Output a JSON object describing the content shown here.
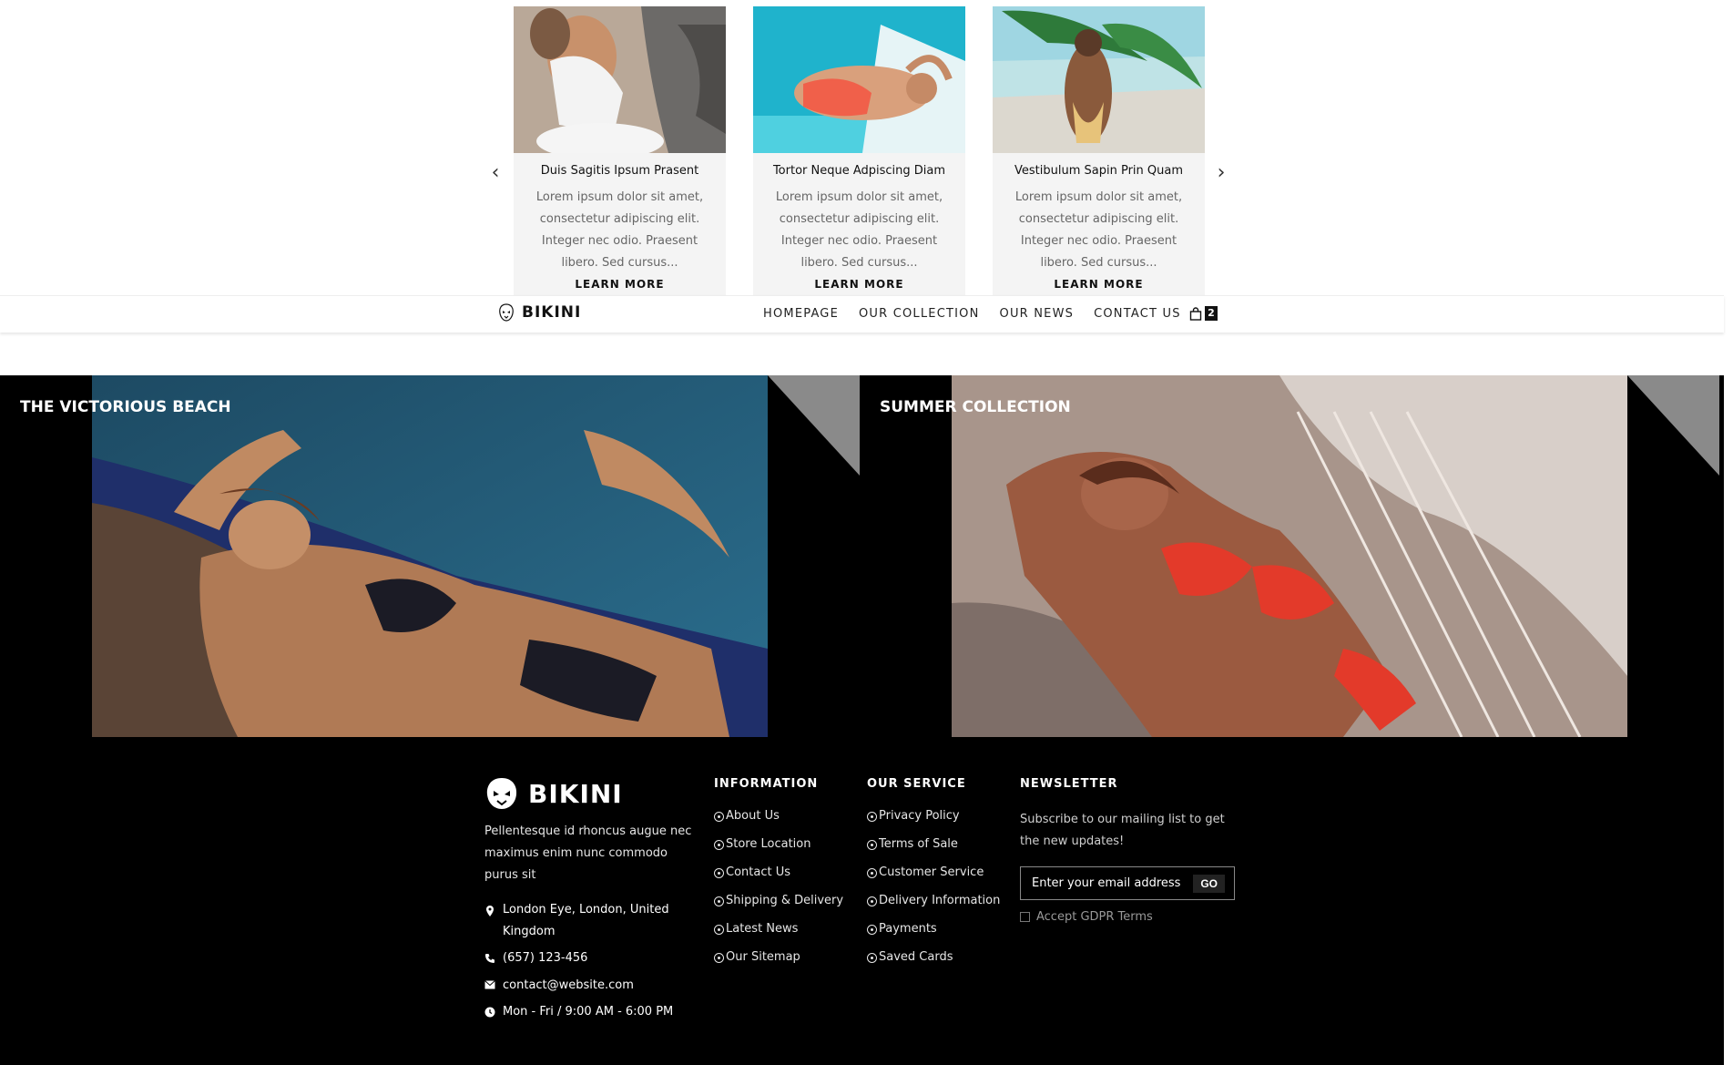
{
  "carousel": {
    "prev_icon": "chevron-left-icon",
    "next_icon": "chevron-right-icon",
    "cards": [
      {
        "title": "Duis Sagitis Ipsum Prasent",
        "text": "Lorem ipsum dolor sit amet, consectetur adipiscing elit. Integer nec odio. Praesent libero. Sed cursus...",
        "more": "LEARN MORE"
      },
      {
        "title": "Tortor Neque Adpiscing Diam",
        "text": "Lorem ipsum dolor sit amet, consectetur adipiscing elit. Integer nec odio. Praesent libero. Sed cursus...",
        "more": "LEARN MORE"
      },
      {
        "title": "Vestibulum Sapin Prin Quam",
        "text": "Lorem ipsum dolor sit amet, consectetur adipiscing elit. Integer nec odio. Praesent libero. Sed cursus...",
        "more": "LEARN MORE"
      }
    ]
  },
  "header": {
    "logo": "BIKINI",
    "nav": [
      "HOMEPAGE",
      "OUR COLLECTION",
      "OUR NEWS",
      "CONTACT US"
    ],
    "cart_icon": "shopping-bag-icon",
    "cart_count": "2"
  },
  "banners": [
    {
      "title": "THE VICTORIOUS BEACH"
    },
    {
      "title": "SUMMER COLLECTION"
    }
  ],
  "footer": {
    "logo": "BIKINI",
    "description": "Pellentesque id rhoncus augue nec maximus enim nunc commodo purus sit",
    "contact": {
      "address": "London Eye, London, United Kingdom",
      "phone": "(657) 123-456",
      "email": "contact@website.com",
      "hours": "Mon - Fri / 9:00 AM - 6:00 PM"
    },
    "information": {
      "title": "INFORMATION",
      "links": [
        "About Us",
        "Store Location",
        "Contact Us",
        "Shipping & Delivery",
        "Latest News",
        "Our Sitemap"
      ]
    },
    "service": {
      "title": "OUR SERVICE",
      "links": [
        "Privacy Policy",
        "Terms of Sale",
        "Customer Service",
        "Delivery Information",
        "Payments",
        "Saved Cards"
      ]
    },
    "newsletter": {
      "title": "NEWSLETTER",
      "text": "Subscribe to our mailing list to get the new updates!",
      "placeholder": "Enter your email address",
      "button": "GO",
      "gdpr": "Accept GDPR Terms"
    }
  },
  "colors": {
    "footer_bg": "#000000",
    "corner_gray": "#8a8a8a"
  }
}
